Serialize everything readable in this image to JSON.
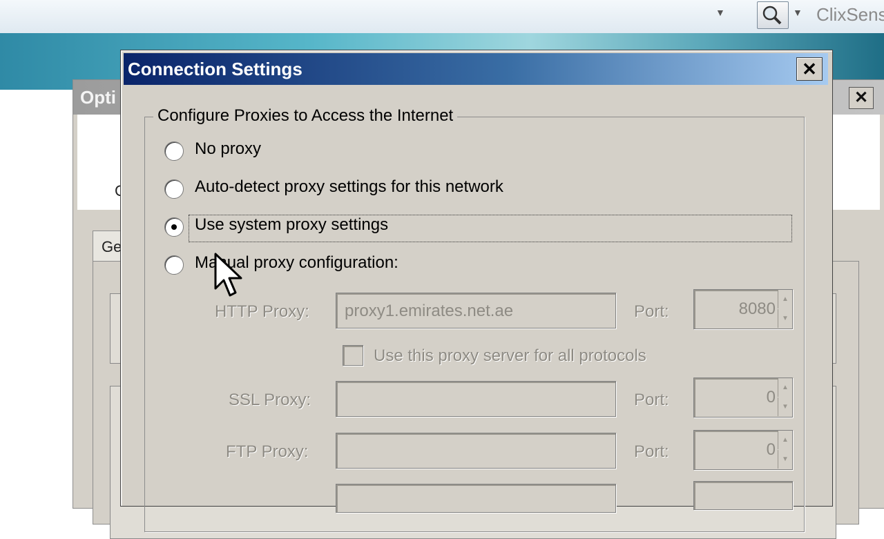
{
  "browser": {
    "search_text": "ClixSense",
    "icons": {
      "dropdown": "chevron-down-icon",
      "search_engine": "magnifier-icon"
    }
  },
  "options_window": {
    "title": "Opti",
    "close_label": "✕",
    "category_label": "G",
    "tab_label": "Ge"
  },
  "dialog": {
    "title": "Connection Settings",
    "close_label": "✕",
    "group_title": "Configure Proxies to Access the Internet",
    "radios": [
      {
        "label": "No proxy",
        "checked": false
      },
      {
        "label": "Auto-detect proxy settings for this network",
        "checked": false
      },
      {
        "label": "Use system proxy settings",
        "checked": true
      },
      {
        "label": "Manual proxy configuration:",
        "checked": false
      }
    ],
    "http_proxy": {
      "label": "HTTP Proxy:",
      "value": "proxy1.emirates.net.ae",
      "port_label": "Port:",
      "port": "8080"
    },
    "use_for_all": {
      "label": "Use this proxy server for all protocols",
      "checked": false
    },
    "ssl_proxy": {
      "label": "SSL Proxy:",
      "value": "",
      "port_label": "Port:",
      "port": "0"
    },
    "ftp_proxy": {
      "label": "FTP Proxy:",
      "value": "",
      "port_label": "Port:",
      "port": "0"
    }
  },
  "colors": {
    "titlebar_start": "#0a246a",
    "titlebar_end": "#a6caf0",
    "dialog_face": "#d4d0c8",
    "disabled_text": "#8e8b84"
  }
}
